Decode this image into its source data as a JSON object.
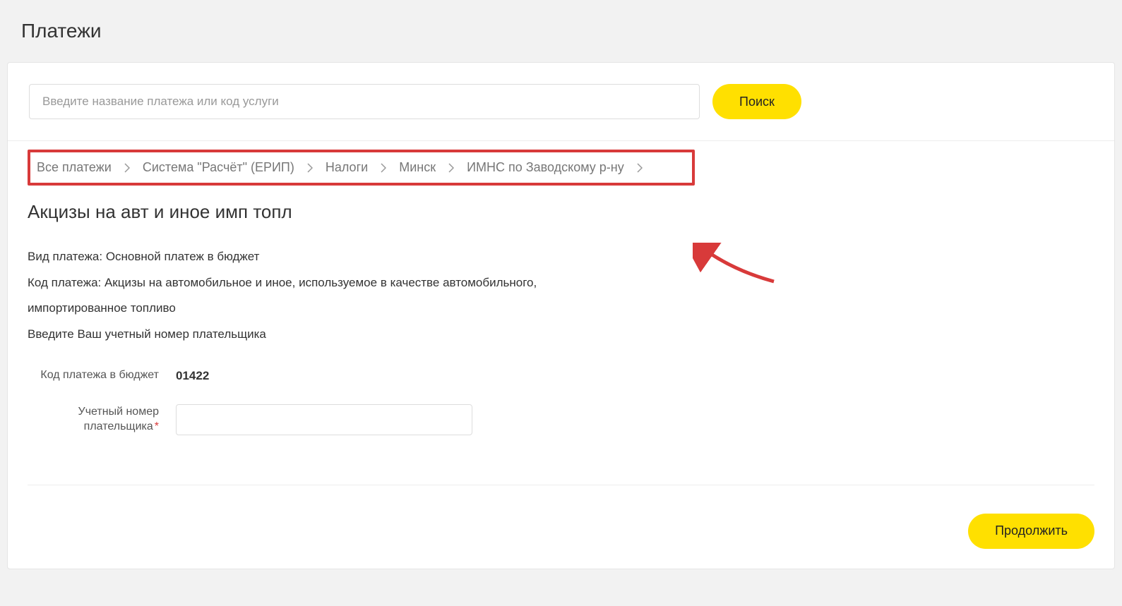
{
  "page_title": "Платежи",
  "search": {
    "placeholder": "Введите название платежа или код услуги",
    "button_label": "Поиск"
  },
  "breadcrumb": [
    "Все платежи",
    "Система \"Расчёт\" (ЕРИП)",
    "Налоги",
    "Минск",
    "ИМНС по Заводскому р-ну"
  ],
  "content": {
    "title": "Акцизы на авт и иное имп топл",
    "info_lines": [
      "Вид платежа: Основной платеж в бюджет",
      "Код платежа: Акцизы на автомобильное и иное, используемое в качестве автомобильного,",
      "импортированное топливо",
      "Введите Ваш учетный номер плательщика"
    ]
  },
  "form": {
    "code_label": "Код платежа в бюджет",
    "code_value": "01422",
    "payer_label": "Учетный номер плательщика",
    "payer_value": ""
  },
  "footer": {
    "continue_label": "Продолжить"
  }
}
